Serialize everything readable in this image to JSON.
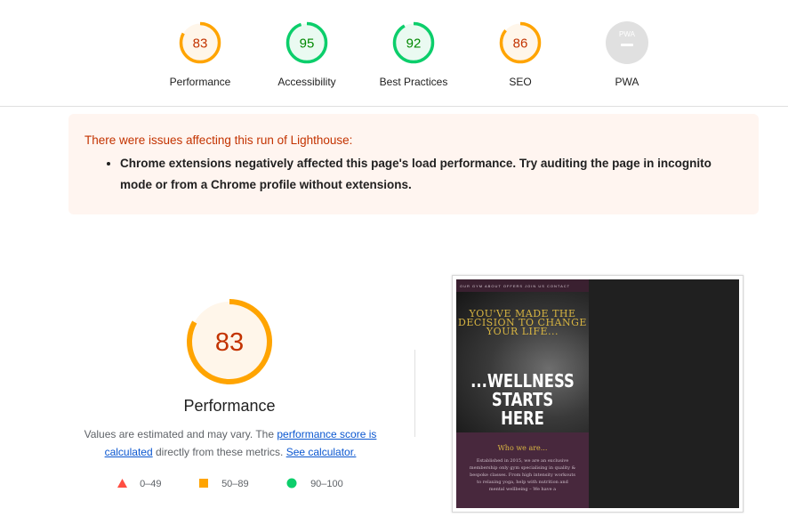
{
  "categories": [
    {
      "name": "Performance",
      "score": "83",
      "value": 83,
      "color": "#ffa400",
      "fill": "#fff6ea",
      "text": "#c33300"
    },
    {
      "name": "Accessibility",
      "score": "95",
      "value": 95,
      "color": "#0cce6b",
      "fill": "#eafaf1",
      "text": "#008800"
    },
    {
      "name": "Best Practices",
      "score": "92",
      "value": 92,
      "color": "#0cce6b",
      "fill": "#eafaf1",
      "text": "#008800"
    },
    {
      "name": "SEO",
      "score": "86",
      "value": 86,
      "color": "#ffa400",
      "fill": "#fff6ea",
      "text": "#c33300"
    },
    {
      "name": "PWA",
      "badge": "PWA"
    }
  ],
  "warning": {
    "title": "There were issues affecting this run of Lighthouse:",
    "items": [
      "Chrome extensions negatively affected this page's load performance. Try auditing the page in incognito mode or from a Chrome profile without extensions."
    ]
  },
  "performance": {
    "score": "83",
    "value": 83,
    "title": "Performance",
    "desc_prefix": "Values are estimated and may vary. The ",
    "link1": "performance score is calculated",
    "desc_middle": " directly from these metrics. ",
    "link2": "See calculator."
  },
  "legend": [
    {
      "icon": "triangle-icon",
      "color": "#ff4e42",
      "label": "0–49"
    },
    {
      "icon": "square-icon",
      "color": "#ffa400",
      "label": "50–89"
    },
    {
      "icon": "circle-icon",
      "color": "#0cce6b",
      "label": "90–100"
    }
  ],
  "thumbnail": {
    "nav": "OUR GYM   ABOUT   OFFERS   JOIN US   CONTACT",
    "hero_top": "YOU'VE MADE THE DECISION TO CHANGE YOUR LIFE...",
    "hero_big": "...WELLNESS STARTS HERE",
    "who": "Who we are...",
    "who_text": "Established in 2015, we are an exclusive membership only gym specialising in quality & bespoke classes. From high intensity workouts to relaxing yoga, help with nutrition and mental wellbeing – We have a"
  }
}
